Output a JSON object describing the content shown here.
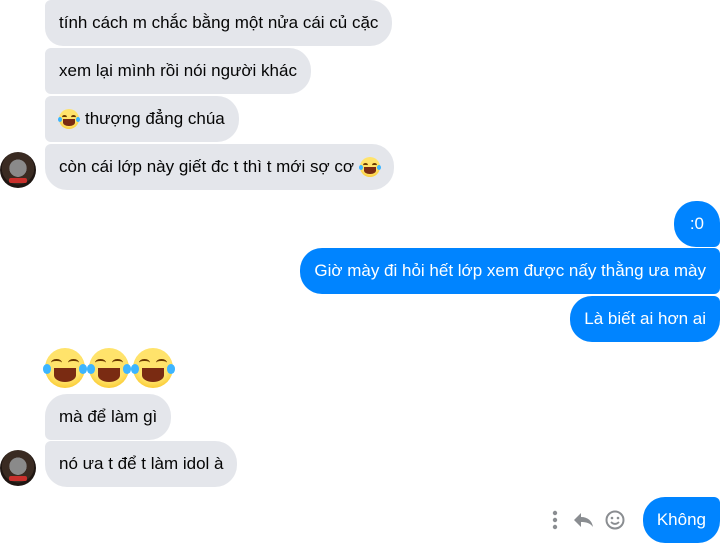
{
  "messages_top": [
    {
      "text": "tính cách m chắc bằng một nửa cái củ cặc"
    },
    {
      "text": "xem lại mình rồi nói người khác"
    },
    {
      "text": "thượng đẳng chúa",
      "emoji": "face-with-tears-of-joy"
    },
    {
      "text": "còn cái lớp này giết đc t thì t mới sợ cơ",
      "emoji_end": "face-with-tears-of-joy"
    }
  ],
  "messages_outgoing": [
    {
      "text": ":0"
    },
    {
      "text": "Giờ mày đi hỏi hết lớp xem được nấy thằng ưa mày"
    },
    {
      "text": "Là biết ai hơn ai"
    }
  ],
  "emoji_row": [
    "face-with-tears-of-joy",
    "face-with-tears-of-joy",
    "face-with-tears-of-joy"
  ],
  "messages_bottom": [
    {
      "text": "mà để làm gì"
    },
    {
      "text": "nó ưa t để t làm idol à"
    }
  ],
  "last_outgoing": {
    "text": "Không"
  },
  "actions": {
    "more_icon": "vertical-ellipsis-icon",
    "reply_icon": "reply-arrow-icon",
    "react_icon": "smiley-icon"
  },
  "colors": {
    "outgoing": "#0084ff",
    "incoming": "#e4e6eb"
  }
}
